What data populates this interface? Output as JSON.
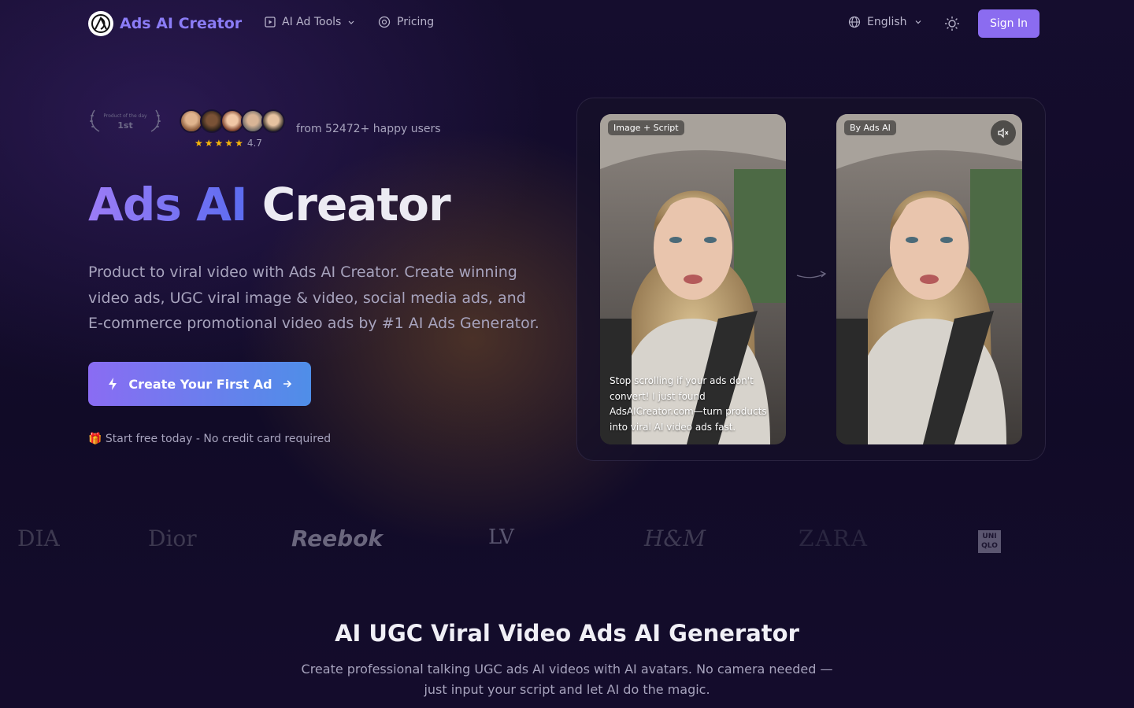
{
  "nav": {
    "logo_text": "Ads AI Creator",
    "tools_label": "AI Ad Tools",
    "pricing_label": "Pricing",
    "language": "English",
    "signin_label": "Sign In"
  },
  "hero": {
    "badge_top": "Product of the day",
    "badge_rank": "1st",
    "rating": "4.7",
    "stars": 5,
    "happy_users": "from 52472+ happy users",
    "title_part1": "Ads AI",
    "title_part2": "Creator",
    "description": "Product to viral video with Ads AI Creator. Create winning video ads, UGC viral image & video, social media ads, and E-commerce promotional video ads by #1 AI Ads Generator.",
    "cta_label": "Create Your First Ad",
    "free_note": "🎁 Start free today - No credit card required"
  },
  "demo": {
    "left_tag": "Image + Script",
    "right_tag": "By Ads AI",
    "caption": "Stop scrolling if your ads don't convert! I just found AdsAICreator.com—turn products into viral AI video ads fast."
  },
  "brands": [
    "DIA",
    "Dior",
    "Reebok",
    "LV",
    "H&M",
    "ZARA",
    "UNI QLO"
  ],
  "section": {
    "title": "AI UGC Viral Video Ads AI Generator",
    "description": "Create professional talking UGC ads AI videos with AI avatars. No camera needed — just input your script and let AI do the magic."
  },
  "colors": {
    "accent": "#8b6cf0",
    "gradient_start": "#8a6cf3",
    "gradient_end": "#4f8ee8",
    "star": "#f5b50a",
    "background": "#150d2e"
  }
}
